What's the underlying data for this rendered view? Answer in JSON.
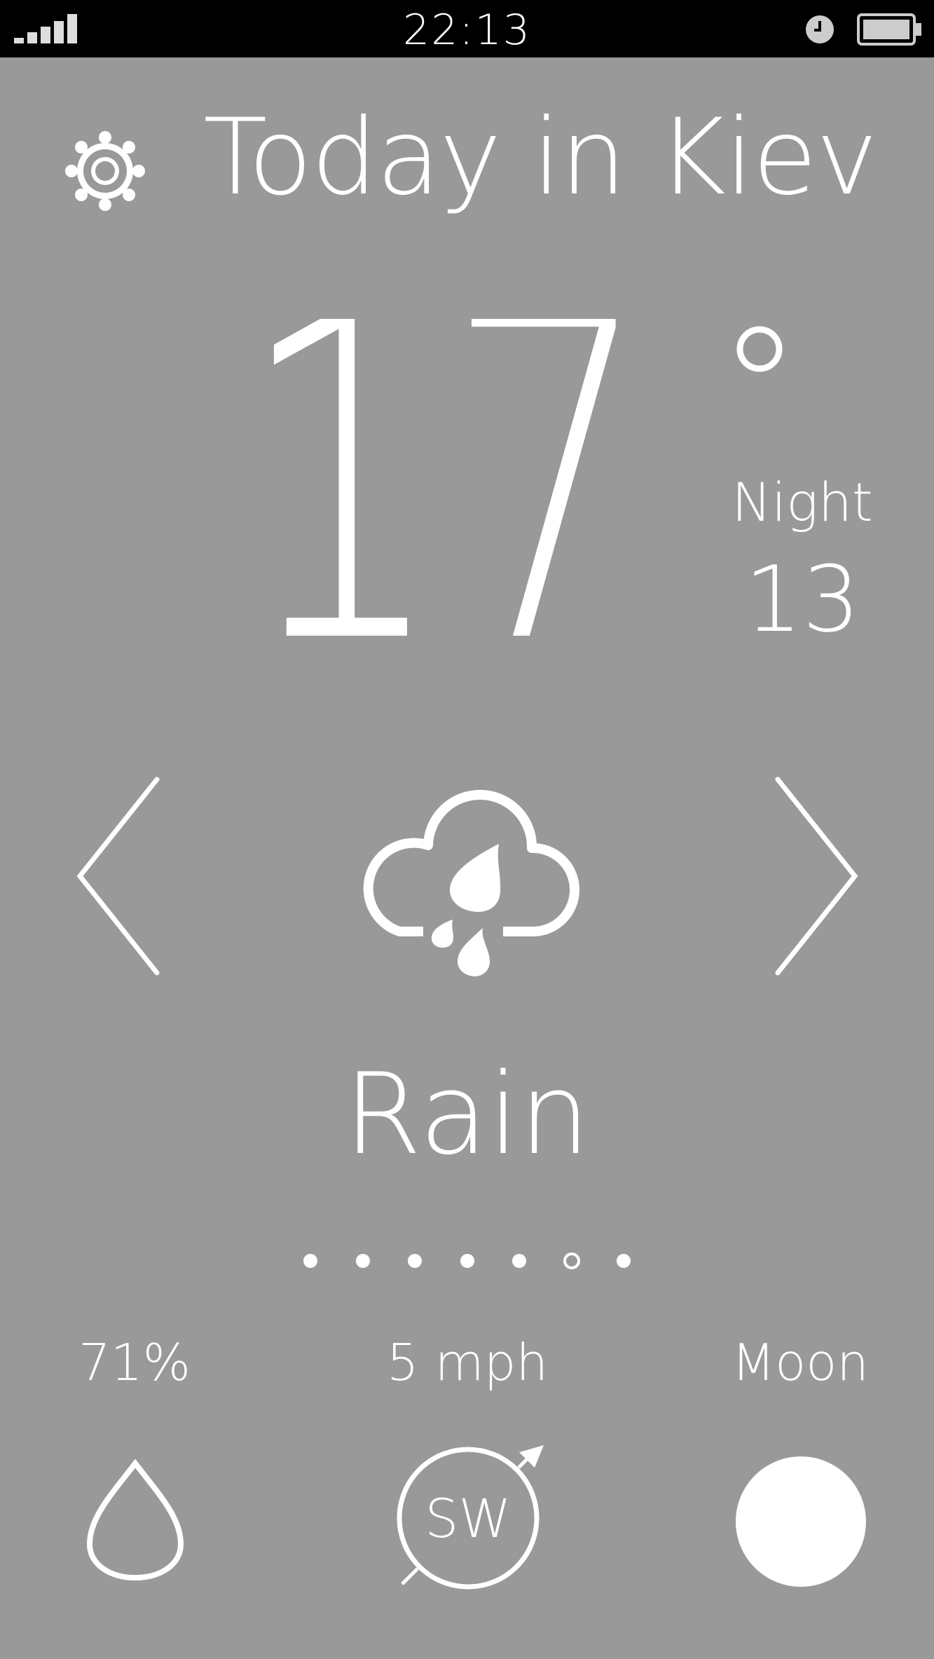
{
  "status_bar": {
    "time": "22:13",
    "icons": [
      "signal-icon",
      "alarm-icon",
      "battery-icon"
    ]
  },
  "header": {
    "title": "Today in Kiev",
    "settings_icon": "gear-icon"
  },
  "current": {
    "temperature": "17",
    "unit_symbol": "°",
    "night_label": "Night",
    "night_temperature": "13"
  },
  "condition": {
    "label": "Rain",
    "icon": "rain-cloud-icon"
  },
  "navigation": {
    "prev_icon": "chevron-left-icon",
    "next_icon": "chevron-right-icon"
  },
  "pager": {
    "total": 7,
    "active_index": 5
  },
  "stats": {
    "humidity": {
      "value": "71%",
      "icon": "water-drop-icon"
    },
    "wind": {
      "value": "5 mph",
      "direction": "SW",
      "icon": "wind-compass-icon"
    },
    "moon": {
      "value": "Moon",
      "icon": "full-moon-icon"
    }
  },
  "colors": {
    "background": "#999999",
    "foreground": "#ffffff",
    "status_bar": "#000000"
  }
}
